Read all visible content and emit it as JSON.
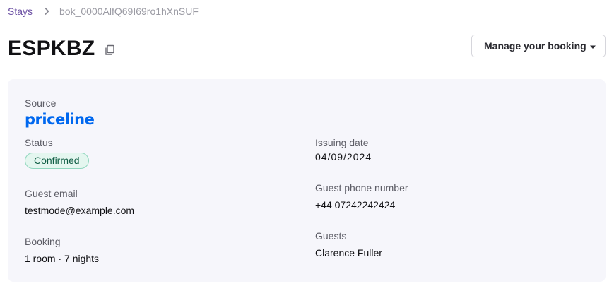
{
  "breadcrumb": {
    "parent": "Stays",
    "current": "bok_0000AlfQ69I69ro1hXnSUF"
  },
  "header": {
    "title": "ESPKBZ",
    "manage_button": "Manage your booking"
  },
  "details": {
    "source_label": "Source",
    "source_logo": "priceline",
    "status_label": "Status",
    "status_value": "Confirmed",
    "issuing_date_label": "Issuing date",
    "issuing_date_value": "04/09/2024",
    "guest_email_label": "Guest email",
    "guest_email_value": "testmode@example.com",
    "guest_phone_label": "Guest phone number",
    "guest_phone_value": "+44 07242242424",
    "booking_label": "Booking",
    "booking_value": "1 room · 7 nights",
    "guests_label": "Guests",
    "guests_value": "Clarence Fuller"
  },
  "colors": {
    "breadcrumb_link": "#6b4fa3",
    "card_background": "#f6f6fb",
    "priceline_blue": "#0068ef",
    "status_badge_bg": "#e4f6ef",
    "status_badge_border": "#8fd6bd",
    "status_badge_text": "#0e5c43"
  },
  "icons": [
    "chevron-right-icon",
    "copy-icon",
    "caret-down-icon"
  ]
}
